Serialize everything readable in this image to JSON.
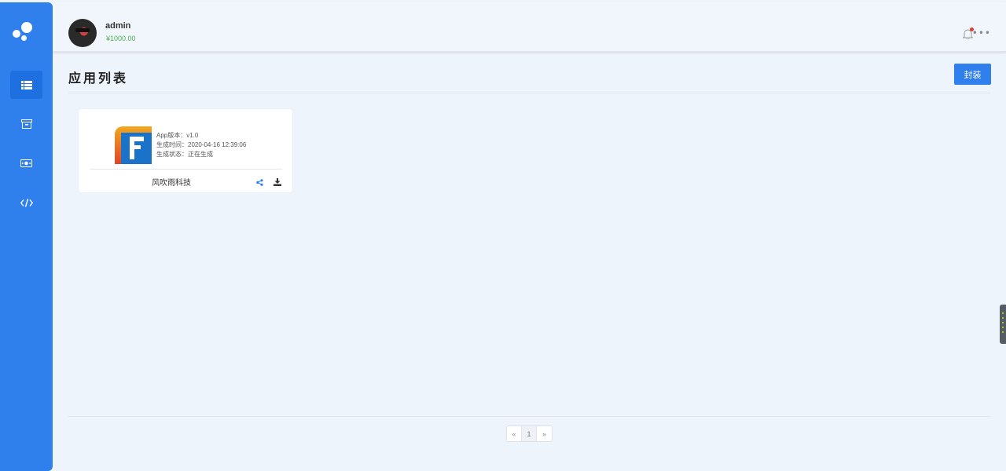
{
  "sidebar": {
    "items": [
      {
        "icon": "list-icon",
        "active": true
      },
      {
        "icon": "archive-icon",
        "active": false
      },
      {
        "icon": "money-icon",
        "active": false
      },
      {
        "icon": "code-icon",
        "active": false
      }
    ]
  },
  "header": {
    "user_name": "admin",
    "balance": "¥1000.00"
  },
  "main": {
    "title": "应用列表",
    "pack_button": "封装"
  },
  "apps": [
    {
      "version_line": "App版本：v1.0",
      "time_line": "生成时间：2020-04-16 12:39:06",
      "status_line": "生成状态：正在生成",
      "name": "风吹雨科技"
    }
  ],
  "pagination": {
    "prev": "«",
    "current": "1",
    "next": "»"
  },
  "colors": {
    "primary": "#2f80ed",
    "balance": "#4caf50",
    "background": "#eef4fc"
  }
}
